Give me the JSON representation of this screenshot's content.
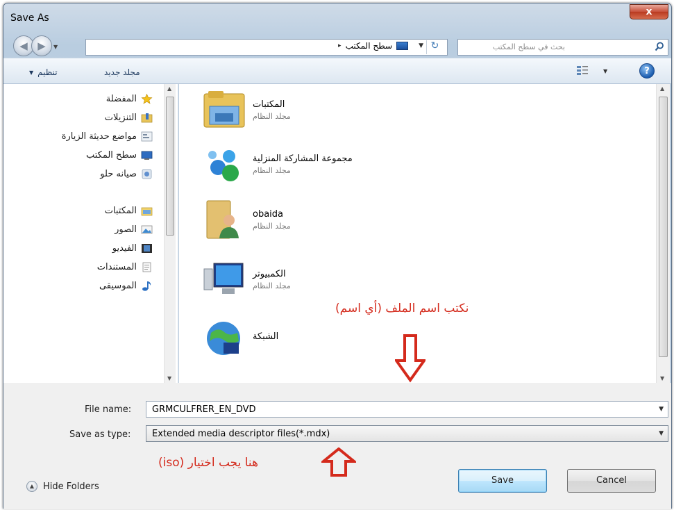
{
  "window": {
    "title": "Save As",
    "close_glyph": "x"
  },
  "address_bar": {
    "back_glyph": "◀",
    "forward_glyph": "▶",
    "recent_glyph": "▼",
    "breadcrumb": "سطح المكتب",
    "breadcrumb_arrow": "▸",
    "dropdown_glyph": "▼",
    "refresh_glyph": "↻"
  },
  "search": {
    "placeholder": "بحث في سطح المكتب"
  },
  "toolbar": {
    "organize_label": "تنظيم",
    "organize_caret": "▼",
    "new_folder_label": "مجلد جديد",
    "views_caret": "▼",
    "help_glyph": "?"
  },
  "nav_pane": {
    "items": [
      {
        "label": "المفضلة",
        "icon": "star-icon"
      },
      {
        "label": "التنزيلات",
        "icon": "downloads-icon"
      },
      {
        "label": "مواضع حديثة الزيارة",
        "icon": "recent-places-icon"
      },
      {
        "label": "سطح المكتب",
        "icon": "desktop-icon"
      },
      {
        "label": "صيانه حلو",
        "icon": "shortcut-icon"
      },
      {
        "label": "المكتبات",
        "icon": "libraries-icon"
      },
      {
        "label": "الصور",
        "icon": "pictures-icon"
      },
      {
        "label": "الفيديو",
        "icon": "videos-icon"
      },
      {
        "label": "المستندات",
        "icon": "documents-icon"
      },
      {
        "label": "الموسيقى",
        "icon": "music-icon"
      }
    ]
  },
  "files": [
    {
      "name": "المكتبات",
      "type": "مجلد النظام",
      "icon": "libraries-folder-icon"
    },
    {
      "name": "مجموعة المشاركة المنزلية",
      "type": "مجلد النظام",
      "icon": "homegroup-icon"
    },
    {
      "name": "obaida",
      "type": "مجلد النظام",
      "icon": "user-folder-icon"
    },
    {
      "name": "الكمبيوتر",
      "type": "مجلد النظام",
      "icon": "computer-icon"
    },
    {
      "name": "الشبكة",
      "type": "",
      "icon": "network-icon"
    }
  ],
  "annotations": {
    "filename_hint": "نكتب اسم الملف (أي اسم)",
    "type_hint": "هنا يجب اختيار (iso)",
    "colors": {
      "annotation_red": "#d42a1c"
    }
  },
  "form": {
    "file_name_label": "File name:",
    "file_name_value": "GRMCULFRER_EN_DVD",
    "save_type_label": "Save as type:",
    "save_type_value": "Extended media descriptor files(*.mdx)",
    "dropdown_glyph": "▼"
  },
  "footer": {
    "hide_folders_label": "Hide Folders",
    "hide_folders_glyph": "▲",
    "save_label": "Save",
    "cancel_label": "Cancel"
  }
}
